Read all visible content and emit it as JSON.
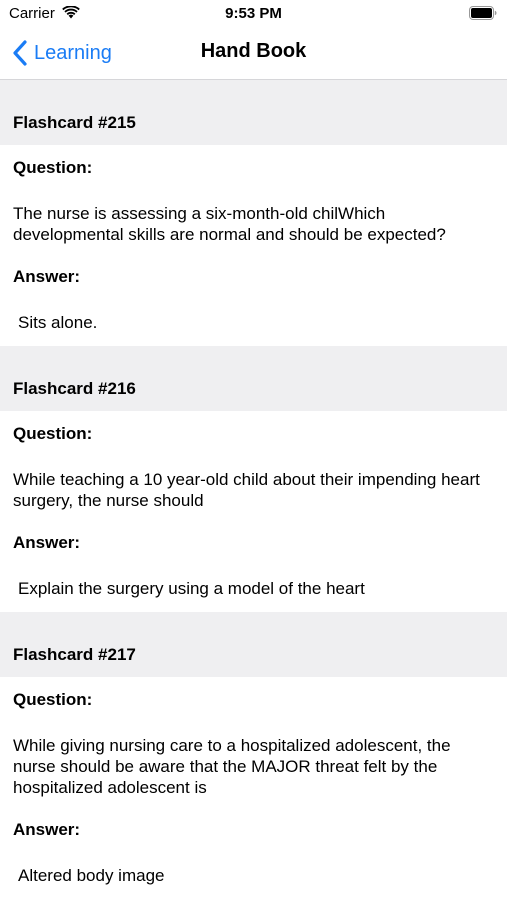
{
  "status_bar": {
    "carrier": "Carrier",
    "time": "9:53 PM"
  },
  "nav": {
    "back_label": "Learning",
    "title": "Hand Book",
    "accent_color": "#1a7cf5"
  },
  "cards": [
    {
      "header": "Flashcard #215",
      "question_label": "Question:",
      "question": "The nurse is assessing a six-month-old chilWhich developmental skills are normal and should be expected?",
      "answer_label": "Answer:",
      "answer": "Sits alone."
    },
    {
      "header": "Flashcard #216",
      "question_label": "Question:",
      "question": "While teaching a 10 year-old child about their impending heart surgery, the nurse should",
      "answer_label": "Answer:",
      "answer": "Explain the surgery using a model of the heart"
    },
    {
      "header": "Flashcard #217",
      "question_label": "Question:",
      "question": "While giving nursing care to a hospitalized adolescent, the nurse should be aware that the MAJOR threat felt by the hospitalized adolescent is",
      "answer_label": "Answer:",
      "answer": "Altered body image"
    }
  ]
}
